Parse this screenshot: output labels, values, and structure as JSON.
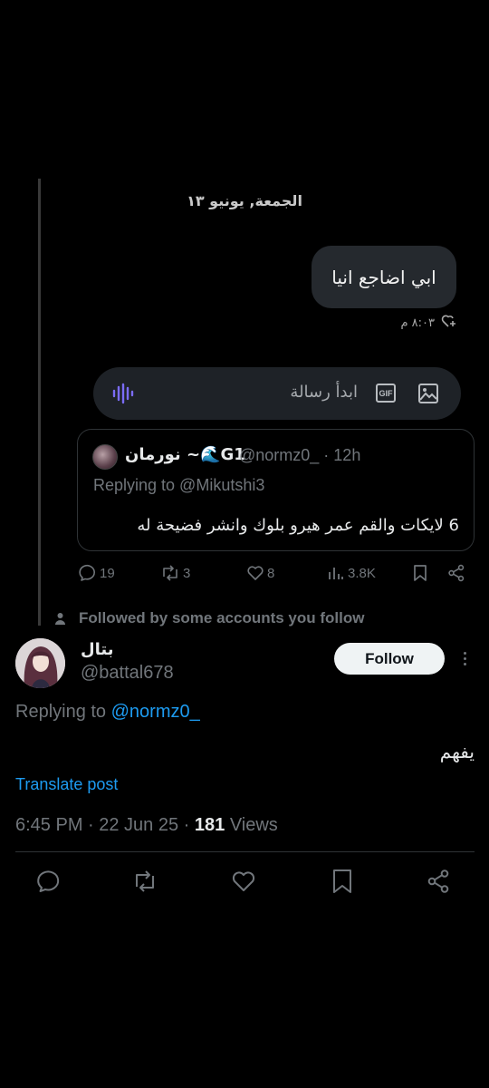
{
  "dm": {
    "date_separator": "الجمعة, يونيو ١٣",
    "message_text": "ابي اضاجع انيا",
    "message_time": "٨:٠٣ م",
    "composer_placeholder": "ابدأ رسالة",
    "gif_label": "GIF"
  },
  "quoted_post": {
    "author_name": "نورمان ~🌊G1",
    "handle_time": "@normz0_ · 12h",
    "replying_to": "Replying to @Mikutshi3",
    "text": "6 لايكات والقم عمر هيرو بلوك وانشر فضيحة له",
    "replies": "19",
    "reposts": "3",
    "likes": "8",
    "views": "3.8K"
  },
  "social_context": "Followed by some accounts you follow",
  "post": {
    "author_name": "بتال",
    "handle": "@battal678",
    "follow_label": "Follow",
    "replying_prefix": "Replying to",
    "replying_mention": "@normz0_",
    "text": "يفهم",
    "translate_label": "Translate post",
    "timestamp": "6:45 PM · 22 Jun 25 · ",
    "views_count": "181",
    "views_label": " Views"
  },
  "colors": {
    "background": "#000000",
    "accent": "#1d9bf0",
    "muted": "#71767b",
    "bubble": "#25292e",
    "mic": "#7b6cf6"
  },
  "icons": [
    "mic-icon",
    "gif-icon",
    "image-icon",
    "heart-plus-icon",
    "reply-icon",
    "repost-icon",
    "like-icon",
    "views-icon",
    "bookmark-icon",
    "share-icon",
    "person-icon",
    "more-icon"
  ]
}
